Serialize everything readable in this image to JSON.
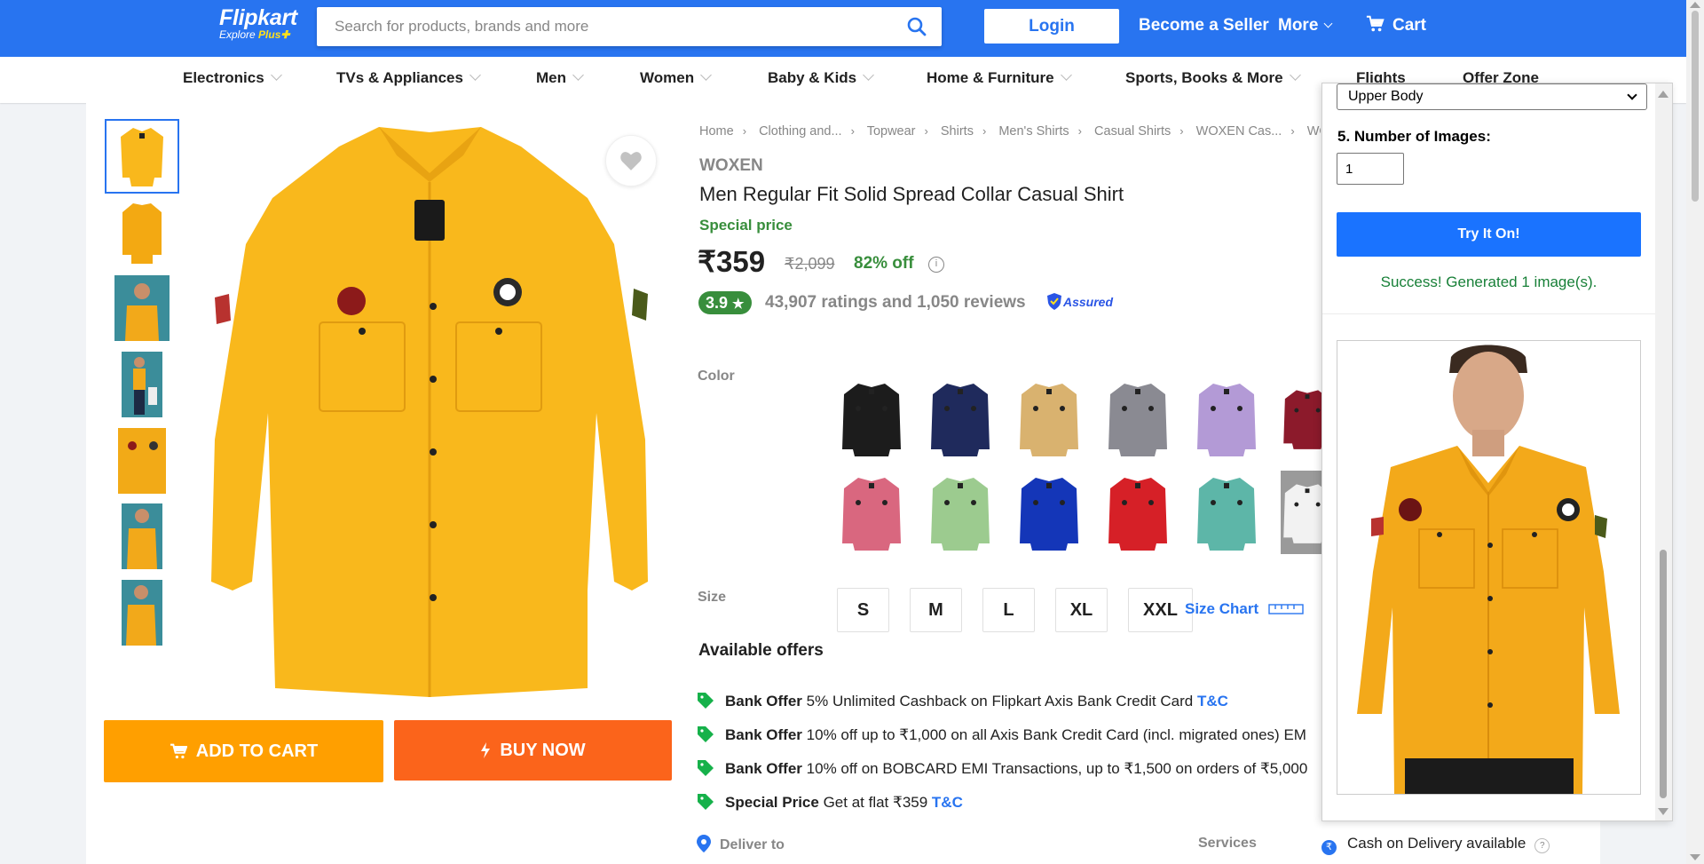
{
  "header": {
    "logo_name": "Flipkart",
    "logo_sub_prefix": "Explore",
    "logo_sub_plus": "Plus",
    "search_placeholder": "Search for products, brands and more",
    "login_label": "Login",
    "seller_label": "Become a Seller",
    "more_label": "More",
    "cart_label": "Cart",
    "brand_color": "#2874f0"
  },
  "categories": [
    "Electronics",
    "TVs & Appliances",
    "Men",
    "Women",
    "Baby & Kids",
    "Home & Furniture",
    "Sports, Books & More",
    "Flights",
    "Offer Zone"
  ],
  "breadcrumbs": [
    "Home",
    "Clothing and...",
    "Topwear",
    "Shirts",
    "Men's Shirts",
    "Casual Shirts",
    "WOXEN Cas...",
    "WO"
  ],
  "product": {
    "brand": "WOXEN",
    "title": "Men Regular Fit Solid Spread Collar Casual Shirt",
    "special_label": "Special price",
    "price": "₹359",
    "mrp": "₹2,099",
    "discount": "82% off",
    "rating": "3.9",
    "reviews": "43,907 ratings and 1,050 reviews",
    "assured_label": "Assured",
    "color_label": "Color",
    "size_label": "Size",
    "sizes": [
      "S",
      "M",
      "L",
      "XL",
      "XXL"
    ],
    "size_chart_label": "Size Chart",
    "shirt_color": "#f9b81c",
    "add_to_cart_label": "ADD TO CART",
    "buy_now_label": "BUY NOW"
  },
  "swatch_colors": [
    "#1c1c1c",
    "#1f2a5c",
    "#d9b26f",
    "#8a8a92",
    "#b39ad6",
    "#8c1a2b",
    "#d9677f",
    "#9ccb8f",
    "#1436b8",
    "#d62027",
    "#5db6a8",
    "#f2f2f2"
  ],
  "offers": {
    "title": "Available offers",
    "items": [
      {
        "type": "Bank Offer",
        "text": "5% Unlimited Cashback on Flipkart Axis Bank Credit Card",
        "tc": "T&C"
      },
      {
        "type": "Bank Offer",
        "text": "10% off up to ₹1,000 on all Axis Bank Credit Card (incl. migrated ones) EM",
        "tc": ""
      },
      {
        "type": "Bank Offer",
        "text": "10% off on BOBCARD EMI Transactions, up to ₹1,500 on orders of ₹5,000",
        "tc": ""
      },
      {
        "type": "Special Price",
        "text": "Get at flat ₹359",
        "tc": "T&C"
      }
    ]
  },
  "delivery": {
    "deliver_label": "Deliver to",
    "services_label": "Services",
    "cod_label": "Cash on Delivery available"
  },
  "panel": {
    "body_select": "Upper Body",
    "num_images_label": "5. Number of Images:",
    "num_images_value": "1",
    "try_label": "Try It On!",
    "success_text": "Success! Generated 1 image(s).",
    "button_color": "#1a73ff"
  }
}
